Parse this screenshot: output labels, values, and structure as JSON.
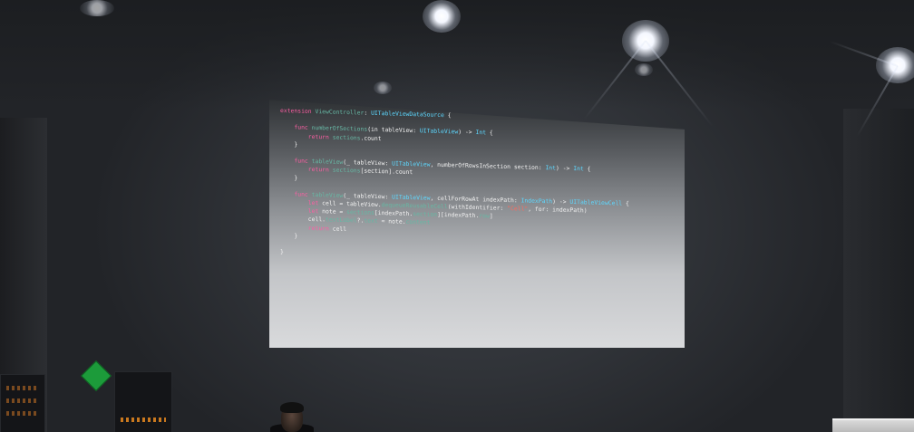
{
  "photo": {
    "subject": "projected-code-slide",
    "colors": {
      "keyword": "#fc5fa3",
      "type": "#5dd8ff",
      "function": "#67b7a4",
      "plain": "#f0f0f0",
      "string": "#fc6a5d"
    }
  },
  "code": {
    "lines": [
      [
        {
          "t": "extension ",
          "c": "kw"
        },
        {
          "t": "ViewController",
          "c": "fn"
        },
        {
          "t": ": ",
          "c": "plain"
        },
        {
          "t": "UITableViewDataSource",
          "c": "ty"
        },
        {
          "t": " {",
          "c": "plain"
        }
      ],
      [],
      [
        {
          "t": "    func ",
          "c": "kw"
        },
        {
          "t": "numberOfSections",
          "c": "fn"
        },
        {
          "t": "(in tableView: ",
          "c": "plain"
        },
        {
          "t": "UITableView",
          "c": "ty"
        },
        {
          "t": ") -> ",
          "c": "plain"
        },
        {
          "t": "Int",
          "c": "ty"
        },
        {
          "t": " {",
          "c": "plain"
        }
      ],
      [
        {
          "t": "        return ",
          "c": "kw"
        },
        {
          "t": "sections",
          "c": "fn"
        },
        {
          "t": ".count",
          "c": "plain"
        }
      ],
      [
        {
          "t": "    }",
          "c": "plain"
        }
      ],
      [],
      [
        {
          "t": "    func ",
          "c": "kw"
        },
        {
          "t": "tableView",
          "c": "fn"
        },
        {
          "t": "(_ tableView: ",
          "c": "plain"
        },
        {
          "t": "UITableView",
          "c": "ty"
        },
        {
          "t": ", numberOfRowsInSection section: ",
          "c": "plain"
        },
        {
          "t": "Int",
          "c": "ty"
        },
        {
          "t": ") -> ",
          "c": "plain"
        },
        {
          "t": "Int",
          "c": "ty"
        },
        {
          "t": " {",
          "c": "plain"
        }
      ],
      [
        {
          "t": "        return ",
          "c": "kw"
        },
        {
          "t": "sections",
          "c": "fn"
        },
        {
          "t": "[section].count",
          "c": "plain"
        }
      ],
      [
        {
          "t": "    }",
          "c": "plain"
        }
      ],
      [],
      [
        {
          "t": "    func ",
          "c": "kw"
        },
        {
          "t": "tableView",
          "c": "fn"
        },
        {
          "t": "(_ tableView: ",
          "c": "plain"
        },
        {
          "t": "UITableView",
          "c": "ty"
        },
        {
          "t": ", cellForRowAt indexPath: ",
          "c": "plain"
        },
        {
          "t": "IndexPath",
          "c": "ty"
        },
        {
          "t": ") -> ",
          "c": "plain"
        },
        {
          "t": "UITableViewCell",
          "c": "ty"
        },
        {
          "t": " {",
          "c": "plain"
        }
      ],
      [
        {
          "t": "        let ",
          "c": "kw"
        },
        {
          "t": "cell = tableView.",
          "c": "plain"
        },
        {
          "t": "dequeueReusableCell",
          "c": "fn"
        },
        {
          "t": "(withIdentifier: ",
          "c": "plain"
        },
        {
          "t": "\"Cell\"",
          "c": "str"
        },
        {
          "t": ", for: indexPath)",
          "c": "plain"
        }
      ],
      [
        {
          "t": "        let ",
          "c": "kw"
        },
        {
          "t": "note = ",
          "c": "plain"
        },
        {
          "t": "sections",
          "c": "fn"
        },
        {
          "t": "[indexPath.",
          "c": "plain"
        },
        {
          "t": "section",
          "c": "fn"
        },
        {
          "t": "][indexPath.",
          "c": "plain"
        },
        {
          "t": "row",
          "c": "fn"
        },
        {
          "t": "]",
          "c": "plain"
        }
      ],
      [
        {
          "t": "        cell.",
          "c": "plain"
        },
        {
          "t": "textLabel",
          "c": "fn"
        },
        {
          "t": "?.",
          "c": "plain"
        },
        {
          "t": "text",
          "c": "fn"
        },
        {
          "t": " = note.",
          "c": "plain"
        },
        {
          "t": "content",
          "c": "fn"
        }
      ],
      [
        {
          "t": "        return ",
          "c": "kw"
        },
        {
          "t": "cell",
          "c": "plain"
        }
      ],
      [
        {
          "t": "    }",
          "c": "plain"
        }
      ],
      [],
      [
        {
          "t": "}",
          "c": "plain"
        }
      ]
    ]
  }
}
